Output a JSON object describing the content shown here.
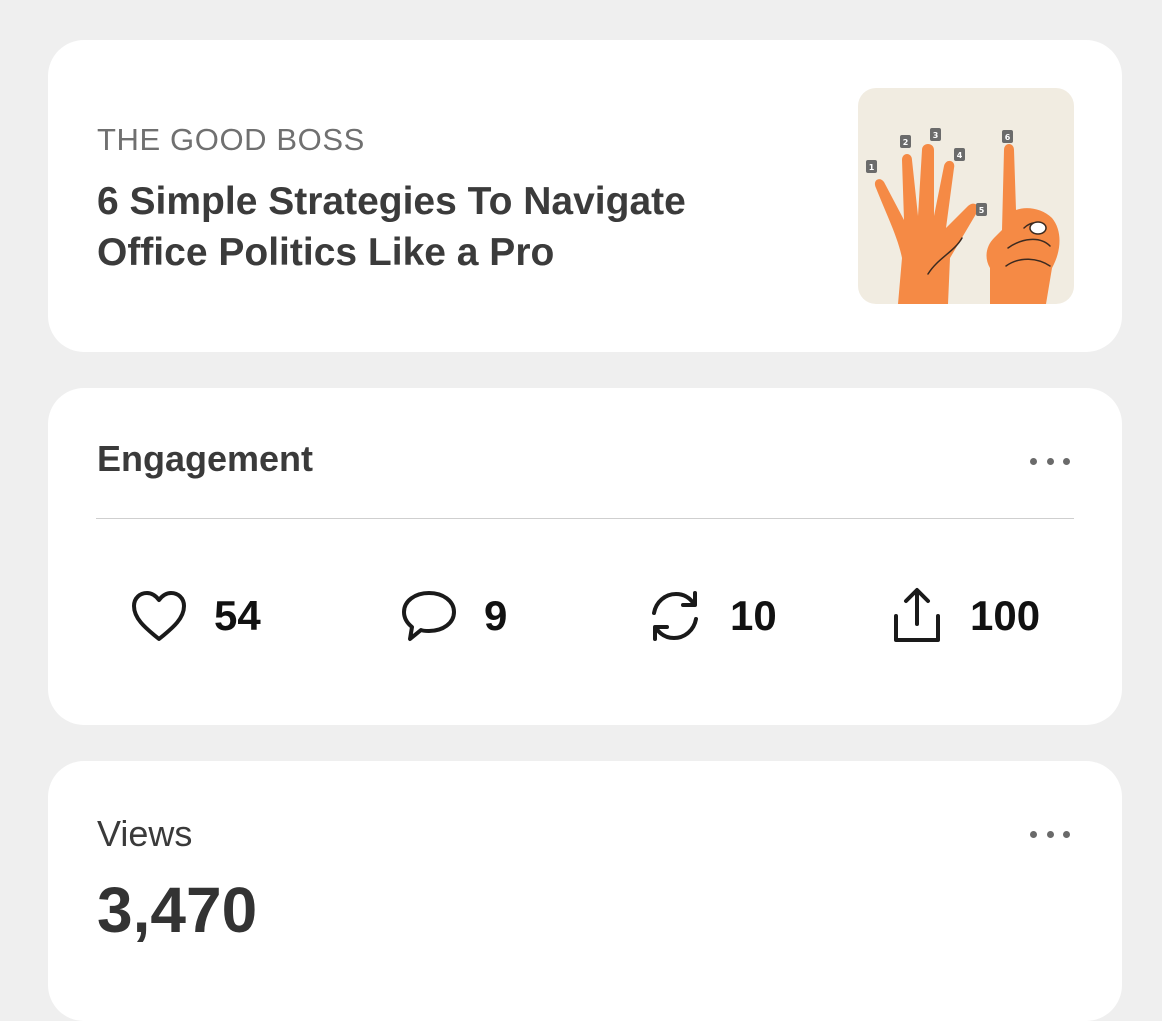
{
  "post": {
    "publication": "THE GOOD BOSS",
    "title": "6 Simple Strategies To Navigate Office Politics Like a Pro",
    "thumbnail_badges": [
      "1",
      "2",
      "3",
      "4",
      "5",
      "6"
    ]
  },
  "engagement": {
    "heading": "Engagement",
    "stats": [
      {
        "icon": "heart-icon",
        "label": "likes",
        "count": "54"
      },
      {
        "icon": "comment-icon",
        "label": "comments",
        "count": "9"
      },
      {
        "icon": "restack-icon",
        "label": "restacks",
        "count": "10"
      },
      {
        "icon": "share-icon",
        "label": "shares",
        "count": "100"
      }
    ]
  },
  "views": {
    "heading": "Views",
    "count": "3,470"
  },
  "colors": {
    "background": "#efefef",
    "card": "#ffffff",
    "thumbnail_bg": "#f1ece1",
    "hand_orange": "#f58a45"
  }
}
